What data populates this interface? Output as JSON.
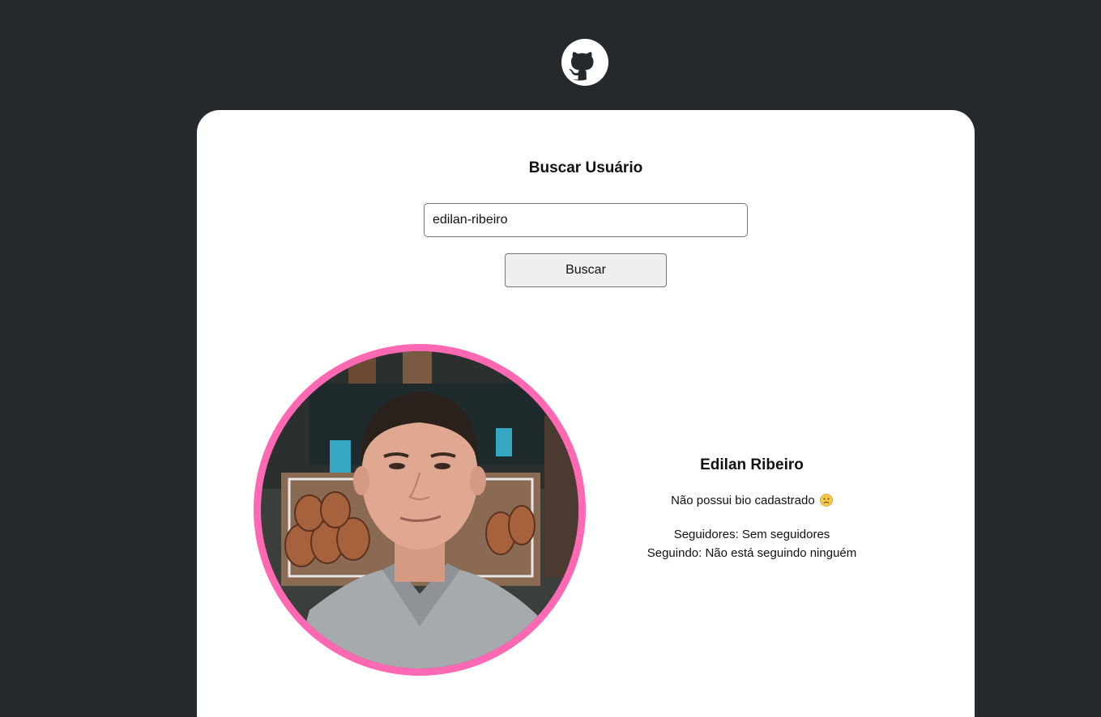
{
  "search": {
    "title": "Buscar Usuário",
    "input_value": "edilan-ribeiro",
    "button_label": "Buscar"
  },
  "profile": {
    "name": "Edilan Ribeiro",
    "bio": "Não possui bio cadastrado",
    "bio_emoji": "sad-face-icon",
    "followers": "Seguidores: Sem seguidores",
    "following": "Seguindo: Não está seguindo ninguém"
  },
  "icons": {
    "logo": "github-logo-icon"
  },
  "colors": {
    "background": "#24292e",
    "card": "#ffffff",
    "avatar_border": "#ff69b4"
  }
}
